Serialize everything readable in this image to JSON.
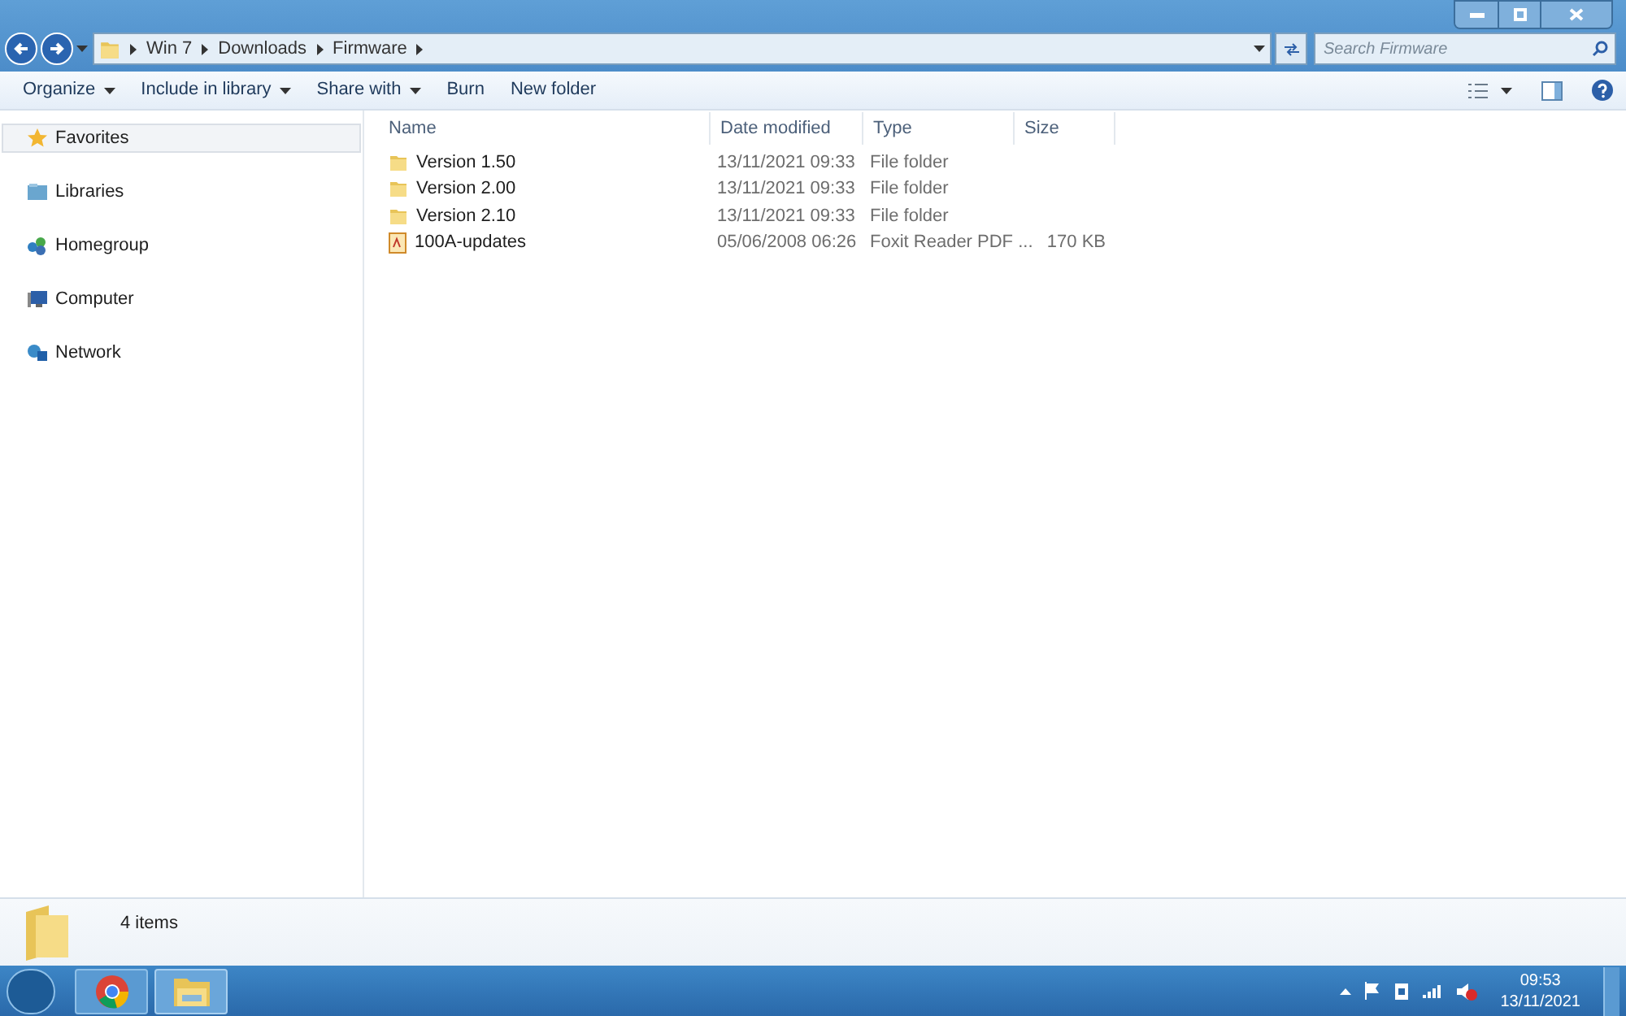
{
  "breadcrumb": [
    "Win 7",
    "Downloads",
    "Firmware"
  ],
  "search": {
    "placeholder": "Search Firmware"
  },
  "toolbar": [
    {
      "label": "Organize",
      "dropdown": true
    },
    {
      "label": "Include in library",
      "dropdown": true
    },
    {
      "label": "Share with",
      "dropdown": true
    },
    {
      "label": "Burn",
      "dropdown": false
    },
    {
      "label": "New folder",
      "dropdown": false
    }
  ],
  "sidebar": {
    "items": [
      {
        "label": "Favorites",
        "kind": "star",
        "selected": true
      },
      {
        "label": "Libraries",
        "kind": "library",
        "selected": false
      },
      {
        "label": "Homegroup",
        "kind": "homegroup",
        "selected": false
      },
      {
        "label": "Computer",
        "kind": "computer",
        "selected": false
      },
      {
        "label": "Network",
        "kind": "network",
        "selected": false
      }
    ]
  },
  "table": {
    "columns": [
      "Name",
      "Date modified",
      "Type",
      "Size"
    ],
    "rows": [
      {
        "kind": "folder",
        "name": "Version 1.50",
        "date": "13/11/2021 09:33",
        "type": "File folder",
        "size": ""
      },
      {
        "kind": "folder",
        "name": "Version 2.00",
        "date": "13/11/2021 09:33",
        "type": "File folder",
        "size": ""
      },
      {
        "kind": "folder",
        "name": "Version 2.10",
        "date": "13/11/2021 09:33",
        "type": "File folder",
        "size": ""
      },
      {
        "kind": "pdf",
        "name": "100A-updates",
        "date": "05/06/2008 06:26",
        "type": "Foxit Reader PDF ...",
        "size": "170 KB"
      }
    ]
  },
  "status_bar": {
    "count": "4 items"
  },
  "taskbar": {
    "time": "09:53",
    "date": "13/11/2021"
  }
}
